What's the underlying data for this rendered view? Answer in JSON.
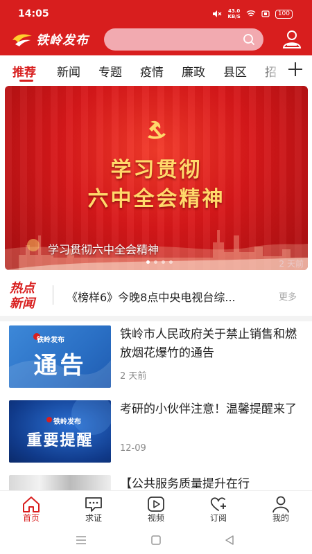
{
  "status_bar": {
    "time": "14:05",
    "net_speed": "43.0",
    "net_unit": "KB/S",
    "battery": "100"
  },
  "header": {
    "app_name": "铁岭发布",
    "search_placeholder": ""
  },
  "tabs": [
    "推荐",
    "新闻",
    "专题",
    "疫情",
    "廉政",
    "县区",
    "招"
  ],
  "banner": {
    "headline_1": "学习贯彻",
    "headline_2": "六中全会精神",
    "caption": "学习贯彻六中全会精神",
    "time": "2 天前",
    "active_slide": 1,
    "slide_count": 4
  },
  "hot_news": {
    "label_1": "热点",
    "label_2": "新闻",
    "text": "《榜样6》今晚8点中央电视台综...",
    "more": "更多"
  },
  "news": [
    {
      "thumb_brand": "铁岭发布",
      "thumb_text": "通告",
      "title": "铁岭市人民政府关于禁止销售和燃放烟花爆竹的通告",
      "date": "2 天前"
    },
    {
      "thumb_brand": "铁岭发布",
      "thumb_text": "重要提醒",
      "title": "考研的小伙伴注意！温馨提醒来了",
      "date": "12-09"
    },
    {
      "thumb_brand": "",
      "thumb_text": "",
      "title": "【公共服务质量提升在行",
      "date": ""
    }
  ],
  "bottom_nav": [
    {
      "label": "首页",
      "icon": "home-icon"
    },
    {
      "label": "求证",
      "icon": "chat-bubble-icon"
    },
    {
      "label": "视频",
      "icon": "play-icon"
    },
    {
      "label": "订阅",
      "icon": "heart-plus-icon"
    },
    {
      "label": "我的",
      "icon": "user-icon"
    }
  ],
  "colors": {
    "brand_red": "#d81e1e",
    "gold": "#ffd96b"
  }
}
